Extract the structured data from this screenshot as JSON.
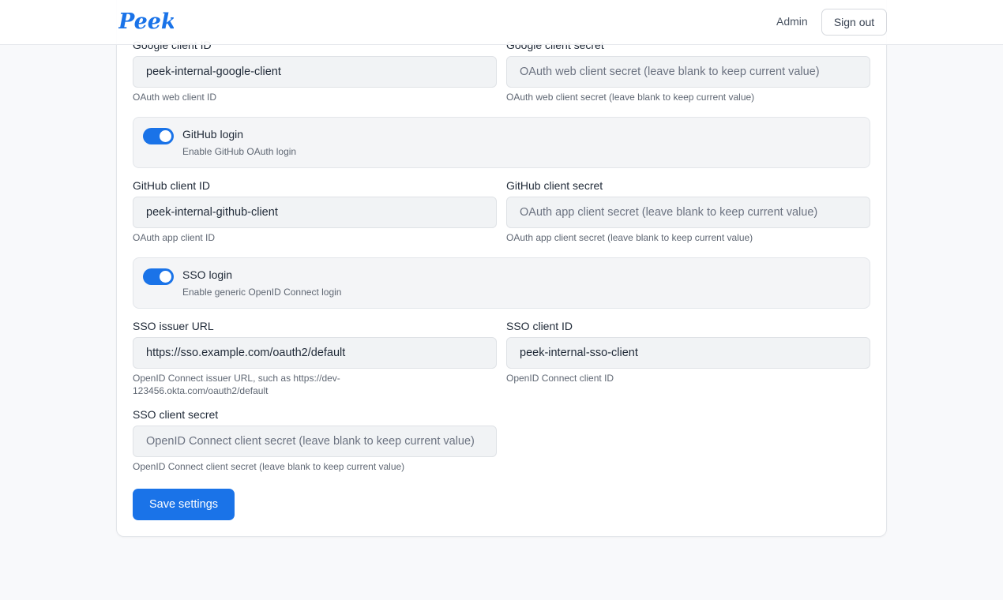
{
  "header": {
    "logo_text": "Peek",
    "admin_label": "Admin",
    "signout_label": "Sign out",
    "brand_color": "#1a73e8"
  },
  "google": {
    "client_id_label": "Google client ID",
    "client_id_value": "peek-internal-google-client",
    "client_id_help": "OAuth web client ID",
    "secret_label": "Google client secret",
    "secret_placeholder": "OAuth web client secret (leave blank to keep current value)",
    "secret_help": "OAuth web client secret (leave blank to keep current value)"
  },
  "github": {
    "toggle_title": "GitHub login",
    "toggle_desc": "Enable GitHub OAuth login",
    "enabled": true,
    "client_id_label": "GitHub client ID",
    "client_id_value": "peek-internal-github-client",
    "client_id_help": "OAuth app client ID",
    "secret_label": "GitHub client secret",
    "secret_placeholder": "OAuth app client secret (leave blank to keep current value)",
    "secret_help": "OAuth app client secret (leave blank to keep current value)"
  },
  "sso": {
    "toggle_title": "SSO login",
    "toggle_desc": "Enable generic OpenID Connect login",
    "enabled": true,
    "issuer_label": "SSO issuer URL",
    "issuer_value": "https://sso.example.com/oauth2/default",
    "issuer_help": "OpenID Connect issuer URL, such as https://dev-123456.okta.com/oauth2/default",
    "client_id_label": "SSO client ID",
    "client_id_value": "peek-internal-sso-client",
    "client_id_help": "OpenID Connect client ID",
    "secret_label": "SSO client secret",
    "secret_placeholder": "OpenID Connect client secret (leave blank to keep current value)",
    "secret_help": "OpenID Connect client secret (leave blank to keep current value)"
  },
  "actions": {
    "save_label": "Save settings"
  }
}
